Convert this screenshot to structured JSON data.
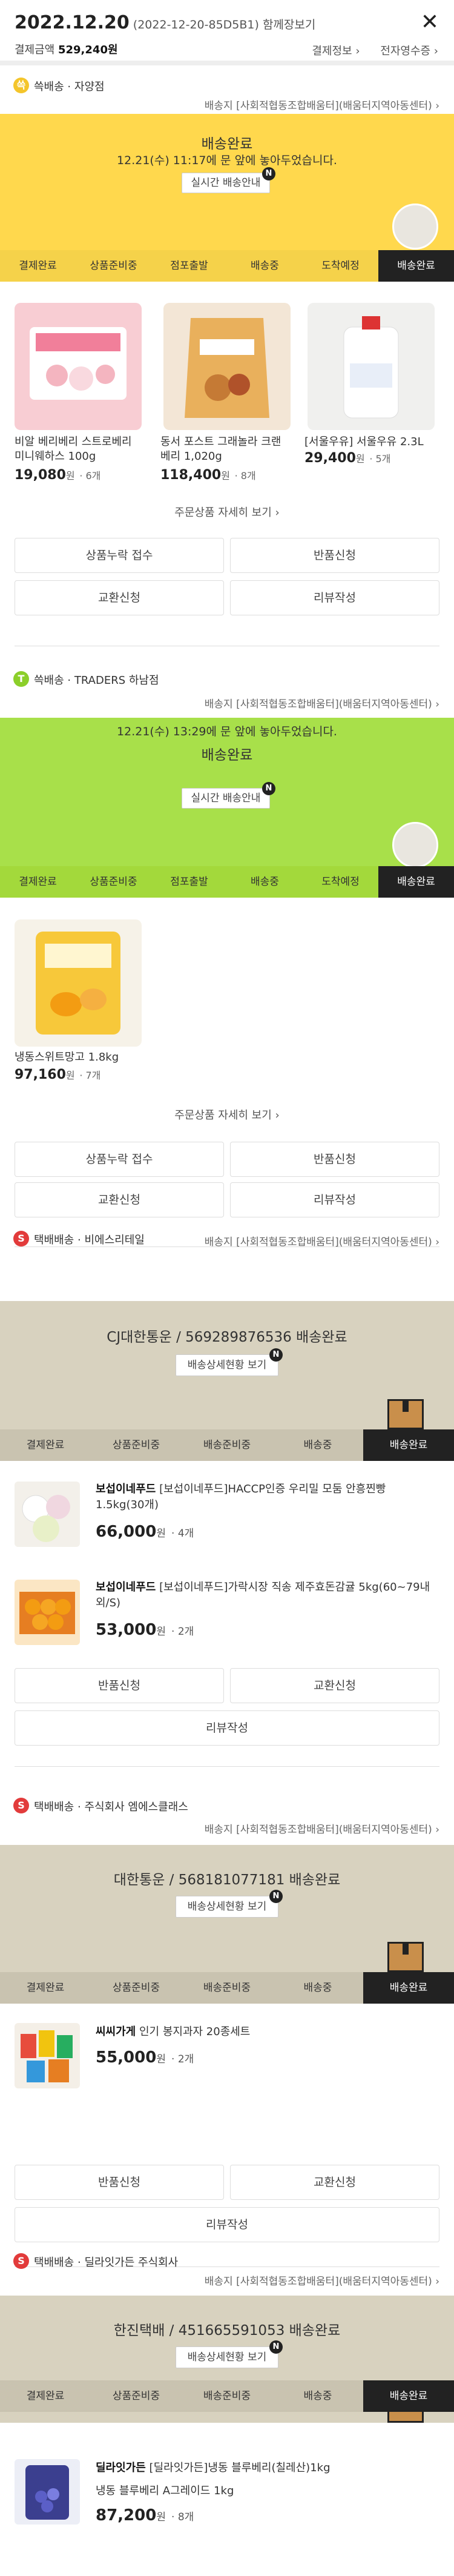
{
  "header": {
    "date": "2022.12.20",
    "order_no": "(2022-12-20-85D5B1) 함께장보기",
    "pay_label": "결제금액",
    "pay_amount": "529,240원",
    "link1": "결제정보",
    "link2": "전자영수증"
  },
  "common": {
    "dest": "배송지 [사회적협동조합배움터](배움터지역아동센터)",
    "detail_link": "주문상품 자세히 보기",
    "intake": "상품누락 접수",
    "return": "반품신청",
    "exchange": "교환신청",
    "review": "리뷰작성",
    "n": "N"
  },
  "s1": {
    "badge": "쓱",
    "type": "쓱배송",
    "sep": "·",
    "store": "자양점",
    "title": "배송완료",
    "msg": "12.21(수) 11:17에 문 앞에 놓아두었습니다.",
    "btn": "실시간 배송안내",
    "steps": [
      "결제완료",
      "상품준비중",
      "점포출발",
      "배송중",
      "도착예정",
      "배송완료"
    ],
    "products": [
      {
        "name": "비알 베리베리 스트로베리 미니웨하스 100g",
        "price": "19,080",
        "unit": "원",
        "qty": "· 6개"
      },
      {
        "name": "동서 포스트 그래놀라 크랜베리 1,020g",
        "price": "118,400",
        "unit": "원",
        "qty": "· 8개"
      },
      {
        "name": "[서울우유] 서울우유 2.3L",
        "price": "29,400",
        "unit": "원",
        "qty": "· 5개"
      }
    ]
  },
  "s2": {
    "badge": "T",
    "type": "쓱배송",
    "sep": "·",
    "store": "TRADERS 하남점",
    "title": "배송완료",
    "msg": "12.21(수) 13:29에 문 앞에 놓아두었습니다.",
    "btn": "실시간 배송안내",
    "steps": [
      "결제완료",
      "상품준비중",
      "점포출발",
      "배송중",
      "도착예정",
      "배송완료"
    ],
    "products": [
      {
        "name": "냉동스위트망고 1.8kg",
        "price": "97,160",
        "unit": "원",
        "qty": "· 7개"
      }
    ]
  },
  "s3": {
    "badge": "S",
    "type": "택배배송",
    "sep": "·",
    "store": "비에스리테일",
    "title": "CJ대한통운 / 569289876536 배송완료",
    "btn": "배송상세현황 보기",
    "steps": [
      "결제완료",
      "상품준비중",
      "배송준비중",
      "배송중",
      "배송완료"
    ],
    "items": [
      {
        "brand": "보섭이네푸드",
        "name": "[보섭이네푸드]HACCP인증 우리밀 모둠 안흥찐빵 1.5kg(30개)",
        "price": "66,000",
        "unit": "원",
        "qty": "· 4개"
      },
      {
        "brand": "보섭이네푸드",
        "name": "[보섭이네푸드]가락시장 직송 제주효돈감귤 5kg(60~79내외/S)",
        "price": "53,000",
        "unit": "원",
        "qty": "· 2개"
      }
    ]
  },
  "s4": {
    "badge": "S",
    "type": "택배배송",
    "sep": "·",
    "store": "주식회사 엠에스클래스",
    "title": "대한통운 / 568181077181 배송완료",
    "btn": "배송상세현황 보기",
    "steps": [
      "결제완료",
      "상품준비중",
      "배송준비중",
      "배송중",
      "배송완료"
    ],
    "items": [
      {
        "brand": "씨씨가게",
        "name": "인기 봉지과자 20종세트",
        "price": "55,000",
        "unit": "원",
        "qty": "· 2개"
      }
    ]
  },
  "s5": {
    "badge": "S",
    "type": "택배배송",
    "sep": "·",
    "store": "딜라잇가든 주식회사",
    "title": "한진택배 / 451665591053 배송완료",
    "btn": "배송상세현황 보기",
    "steps": [
      "결제완료",
      "상품준비중",
      "배송준비중",
      "배송중",
      "배송완료"
    ],
    "items": [
      {
        "brand": "딜라잇가든",
        "name": "[딜라잇가든]냉동 블루베리(칠레산)1kg",
        "sub": "냉동 블루베리 A그레이드 1kg",
        "price": "87,200",
        "unit": "원",
        "qty": "· 8개"
      }
    ]
  },
  "colors": {
    "yellow": "#ffd84d",
    "green": "#a8e04a",
    "beige": "#d8d2bf",
    "ssg": "#f4c52b",
    "traders": "#8ccf2a",
    "parcel": "#e23b3b"
  }
}
